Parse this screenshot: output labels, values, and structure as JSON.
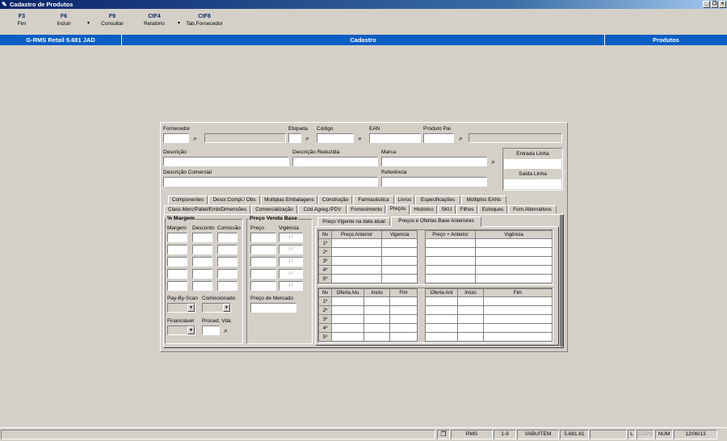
{
  "window": {
    "title": "Cadastro de Produtos"
  },
  "toolbar": [
    {
      "key": "F3",
      "label": "Fim"
    },
    {
      "key": "F6",
      "label": "Incluir"
    },
    {
      "key": "F9",
      "label": "Consultar"
    },
    {
      "key": "CtF4",
      "label": "Relatório"
    },
    {
      "key": "CtF8",
      "label": "Tab.Fornecedor"
    }
  ],
  "infobar": {
    "system": "G-RMS Retail 5.681 JAD",
    "section": "Cadastro",
    "module": "Produtos"
  },
  "form": {
    "fornecedor": "Fornecedor",
    "etiqueta": "Etiqueta",
    "codigo": "Código",
    "ean": "EAN",
    "produto_pai": "Produto Pai",
    "descricao": "Descrição",
    "descricao_reduzida": "Descrição Reduzida",
    "marca": "Marca",
    "descricao_comercial": "Descrição Comercial",
    "referencia": "Referência",
    "entrada_linha": "Entrada Linha",
    "saida_linha": "Saída Linha"
  },
  "tabs_row1": [
    "Componentes",
    "Descr.Compl./ Obs",
    "Multiplas Embalagens",
    "Construção",
    "Farmacêutica",
    "Livros",
    "Especificações",
    "Múltiplos EANs"
  ],
  "tabs_row2": [
    "Class.Merc/Pallet/Emb/Dimensões",
    "Comercialização",
    "Cód.Agreg./PDV",
    "Fornecimento",
    "Preços",
    "Histórico",
    "SKU",
    "Filhos",
    "Estoques",
    "Forn.Alternativos"
  ],
  "margem": {
    "title": "% Margem",
    "cols": [
      "Margem",
      "Desconto",
      "Comissão"
    ]
  },
  "preco_venda": {
    "title": "Preço Venda Base",
    "cols": [
      "Preço",
      "Vigência"
    ],
    "date_placeholder": "/ /",
    "mercado": "Preço de Mercado"
  },
  "extra": {
    "pay_by_scan": "Pay-By-Scan",
    "comissionado": "Comissionado",
    "financiavel": "Financiável",
    "proced_vda": "Proced. Vda"
  },
  "subtabs": [
    "Preço Vigente na data atual",
    "Preços e Ofertas Base Anteriores"
  ],
  "grid1": {
    "headers": [
      "Nv",
      "Preço Anterior",
      "Vigencia",
      "Preço + Anterior",
      "Vigência"
    ],
    "rows": [
      "1º",
      "2º",
      "3º",
      "4º",
      "5º"
    ]
  },
  "grid2": {
    "headers": [
      "Nv",
      "Oferta Atu",
      "Inicio",
      "Fim",
      "Oferta Ant",
      "Inicio",
      "Fim"
    ],
    "rows": [
      "1º",
      "2º",
      "3º",
      "4º",
      "5º"
    ]
  },
  "status": {
    "user": "RMS",
    "page": "1-9",
    "table": "VABUITEM",
    "version": "5.681.61",
    "l": "L",
    "caps": "CAPS",
    "num": "NUM",
    "date": "12/06/13"
  }
}
